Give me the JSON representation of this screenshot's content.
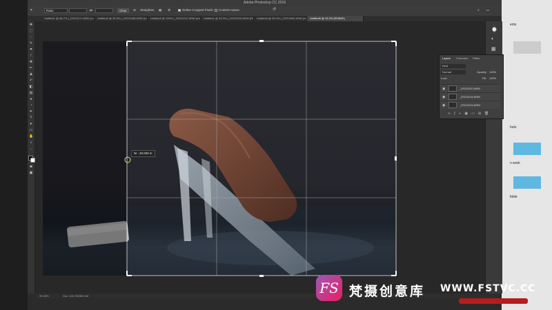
{
  "window": {
    "title": "Adobe Photoshop CC 2018"
  },
  "options_bar": {
    "ratio": "Ratio",
    "clear": "Clear",
    "straighten": "Straighten",
    "delete_cropped": "Delete Cropped Pixels",
    "content_aware": "Content-Aware"
  },
  "tabs": [
    {
      "label": "Untitled1 @ 66.7% (_DSC0171.ARW (merged), R..."
    },
    {
      "label": "Untitled2 @ 33.3% (_DSC0188.ARW (merged), R..."
    },
    {
      "label": "Untitled3 @ 100% (_DSC0212.ARW (merged), RG..."
    },
    {
      "label": "Untitled1 @ 33.3% (_DSC0216.ARW (RGB/8*..."
    },
    {
      "label": "Untitled4 @ 33.3% (_DSC0004.ARW (merged), R..."
    },
    {
      "label": "Untitled5 @ 33.3% (RGB/8*)"
    }
  ],
  "crop": {
    "readout": "W : 20.000 in"
  },
  "status": {
    "zoom": "33.33%",
    "doc": "Doc: 103.7M/303.1M"
  },
  "layers_panel": {
    "tabs": [
      "Layers",
      "Channels",
      "Paths"
    ],
    "kind": "Kind",
    "blend": "Normal",
    "opacity_label": "Opacity:",
    "opacity": "100%",
    "lock_label": "Lock:",
    "fill_label": "Fill:",
    "fill": "100%",
    "layers": [
      "_DSC0220.ARW",
      "_DSC0218.ARW",
      "_DSC0215.ARW"
    ]
  },
  "desktop_labels": [
    "ents",
    "hots",
    "n work",
    "folde"
  ],
  "watermark": {
    "logo": "FS",
    "cn": "梵摄创意库",
    "en": "WWW.FSTVC.CC"
  },
  "colors": {
    "chocolate": "#6e4434",
    "accent_brand": "#9b59b6"
  }
}
